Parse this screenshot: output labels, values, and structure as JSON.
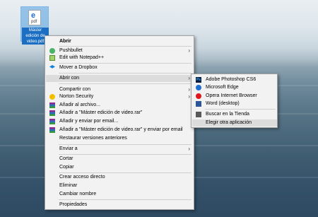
{
  "desktop_file": {
    "icon_name": "edge-pdf-file-icon",
    "type_text": "pdf",
    "caption": "Máster edición de video.pdf"
  },
  "context_menu": {
    "items": [
      {
        "label": "Abrir",
        "icon": null
      },
      {
        "label": "Pushbullet",
        "icon": "pushbullet-icon"
      },
      {
        "label": "Edit with Notepad++",
        "icon": "notepad-plus-icon"
      },
      {
        "label": "Mover a Dropbox",
        "icon": "dropbox-icon"
      },
      {
        "label": "Abrir con",
        "icon": null
      },
      {
        "label": "Compartir con",
        "icon": null
      },
      {
        "label": "Norton Security",
        "icon": "norton-icon"
      },
      {
        "label": "Añadir al archivo...",
        "icon": "winrar-icon"
      },
      {
        "label": "Añadir a \"Máster edición de video.rar\"",
        "icon": "winrar-icon"
      },
      {
        "label": "Añadir y enviar por email...",
        "icon": "winrar-icon"
      },
      {
        "label": "Añadir a \"Máster edición de video.rar\" y enviar por email",
        "icon": "winrar-icon"
      },
      {
        "label": "Restaurar versiones anteriores",
        "icon": null
      },
      {
        "label": "Enviar a",
        "icon": null
      },
      {
        "label": "Cortar",
        "icon": null
      },
      {
        "label": "Copiar",
        "icon": null
      },
      {
        "label": "Crear acceso directo",
        "icon": null
      },
      {
        "label": "Eliminar",
        "icon": null
      },
      {
        "label": "Cambiar nombre",
        "icon": null
      },
      {
        "label": "Propiedades",
        "icon": null
      }
    ],
    "arrow_glyph": "›"
  },
  "open_with_submenu": {
    "items": [
      {
        "label": "Adobe Photoshop CS6",
        "icon": "photoshop-icon",
        "icon_text": "Ps"
      },
      {
        "label": "Microsoft Edge",
        "icon": "edge-icon"
      },
      {
        "label": "Opera Internet Browser",
        "icon": "opera-icon"
      },
      {
        "label": "Word (desktop)",
        "icon": "word-icon"
      },
      {
        "label": "Buscar en la Tienda",
        "icon": "store-icon"
      },
      {
        "label": "Elegir otra aplicación",
        "icon": null
      }
    ]
  }
}
